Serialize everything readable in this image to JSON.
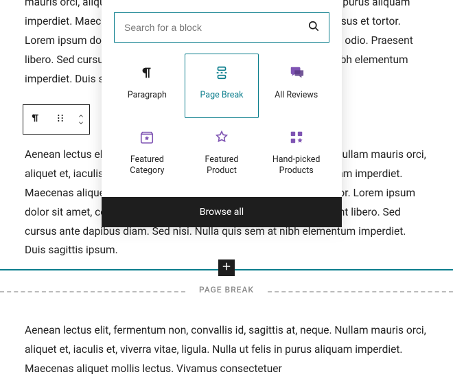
{
  "paragraphs": {
    "p1": "mauris orci, aliquet et, iaculis et, viverra vitae, ligula. Nulla ut felis in purus aliquam imperdiet. Maecenas aliquet mollis lectus. Vivamus consectetuer risus et tortor. Lorem ipsum dolor sit amet, consectetur adipiscing elit. Integer nec odio. Praesent libero. Sed cursus ante dapibus diam. Sed nisi. Nulla quis sem at nibh elementum imperdiet. Duis sagittis ipsum.",
    "p2": "Aenean lectus elit, fermentum non, convallis id, sagittis at, neque. Nullam mauris orci, aliquet et, iaculis et, viverra vitae, ligula. Nulla ut felis in purus aliquam imperdiet. Maecenas aliquet mollis lectus. Vivamus consectetuer risus et tortor. Lorem ipsum dolor sit amet, consectetur adipiscing elit. Integer nec odio. Praesent libero. Sed cursus ante dapibus diam. Sed nisi. Nulla quis sem at nibh elementum imperdiet. Duis sagittis ipsum.",
    "p3": "Aenean lectus elit, fermentum non, convallis id, sagittis at, neque. Nullam mauris orci, aliquet et, iaculis et, viverra vitae, ligula. Nulla ut felis in purus aliquam imperdiet. Maecenas aliquet mollis lectus. Vivamus consectetuer"
  },
  "page_break_label": "PAGE BREAK",
  "inserter": {
    "search_placeholder": "Search for a block",
    "browse_all": "Browse all",
    "blocks": [
      {
        "label": "Paragraph"
      },
      {
        "label": "Page Break"
      },
      {
        "label": "All Reviews"
      },
      {
        "label": "Featured Category"
      },
      {
        "label": "Featured Product"
      },
      {
        "label": "Hand-picked Products"
      }
    ]
  }
}
